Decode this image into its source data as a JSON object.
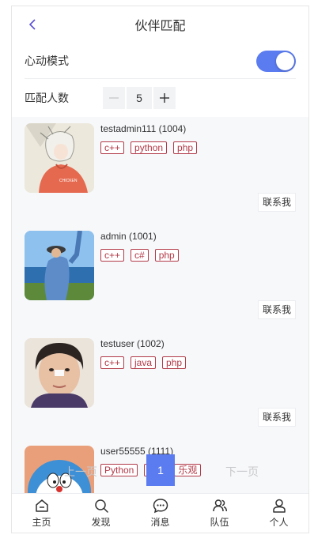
{
  "header": {
    "title": "伙伴匹配"
  },
  "settings": {
    "heart_mode_label": "心动模式",
    "heart_mode_on": true,
    "match_count_label": "匹配人数",
    "match_count_value": "5"
  },
  "users": [
    {
      "name": "testadmin111 (1004)",
      "tags": [
        "c++",
        "python",
        "php"
      ],
      "contact_label": "联系我"
    },
    {
      "name": "admin (1001)",
      "tags": [
        "c++",
        "c#",
        "php"
      ],
      "contact_label": "联系我"
    },
    {
      "name": "testuser (1002)",
      "tags": [
        "c++",
        "java",
        "php"
      ],
      "contact_label": "联系我"
    },
    {
      "name": "user55555 (1111)",
      "tags": [
        "Python",
        "",
        "乐观"
      ]
    }
  ],
  "pagination": {
    "prev_label": "上一页",
    "current_page": "1",
    "next_label": "下一页"
  },
  "tabbar": {
    "items": [
      {
        "label": "主页",
        "icon": "home-icon"
      },
      {
        "label": "发现",
        "icon": "search-icon"
      },
      {
        "label": "消息",
        "icon": "chat-icon"
      },
      {
        "label": "队伍",
        "icon": "team-icon"
      },
      {
        "label": "个人",
        "icon": "user-icon"
      }
    ]
  },
  "colors": {
    "accent": "#5b7cf0",
    "tag": "#b23a48"
  }
}
